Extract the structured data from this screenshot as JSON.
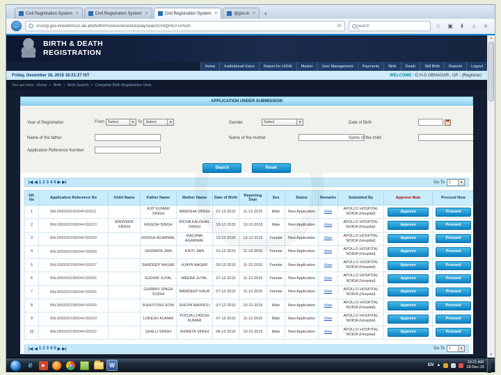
{
  "colors": {
    "navy": "#141d31",
    "menu_blue": "#1d3f68",
    "bar_blue": "#cfeaf8",
    "panel_title_blue": "#a5dff7",
    "button_blue": "#0b7fc0",
    "link_blue": "#2255bb",
    "alert_red": "#b00000"
  },
  "browser": {
    "tabs": [
      {
        "title": "Civil Registration System",
        "close": "×"
      },
      {
        "title": "Civil Registration System",
        "close": "×"
      },
      {
        "title": "Civil Registration System",
        "close": "×"
      },
      {
        "title": "@gov.in",
        "close": "×"
      }
    ],
    "new_tab": "+",
    "back_glyph": "←",
    "url": "crsorgi.gov.in/web/mccs.ab.arb/birth/Process/recordDisplaySearch/V9@HL0TA%20",
    "reload_glyph": "⟳",
    "search_placeholder": "Search",
    "toolbar_icons": {
      "star": "☆",
      "bookmarks": "▣",
      "download": "⬇",
      "home": "⌂",
      "menu": "≡"
    },
    "scrollbar": {
      "up": "▲",
      "down": "▼"
    }
  },
  "site": {
    "title_line1": "BIRTH & DEATH",
    "title_line2": "REGISTRATION",
    "nav": [
      "Home",
      "Institutional Users",
      "Report for UIDAI",
      "Master",
      "User Management",
      "Payments",
      "Birth",
      "Death",
      "Still Birth",
      "Reports",
      "Logout"
    ],
    "datetime": "Friday, December 18, 2015 18:21:27 IST",
    "welcome_label": "WELCOME :",
    "welcome_user": "D.H.O GBNAGAR , UP - (Registrar)",
    "breadcrumb_prefix": "You are here:",
    "breadcrumbs": [
      "Home",
      "Birth",
      "Birth Search",
      "Complete Birth Registration View"
    ]
  },
  "panel": {
    "title": "APPLICATION UNDER SUBMISSION",
    "form": {
      "year_label": "Year of Registration",
      "from_label": "From",
      "to_label": "To",
      "select_placeholder": "Select",
      "gender_label": "Gender",
      "dob_label": "Date of Birth",
      "father_label": "Name of the father",
      "mother_label": "Name of the mother",
      "child_label": "Name of the child",
      "appref_label": "Application Reference Number",
      "search_button": "Search",
      "reset_button": "Reset",
      "dropdown_arrow": "▾"
    },
    "pagination": {
      "first": "|◀",
      "prev": "◀",
      "next": "▶",
      "last": "▶|",
      "pages": [
        "1",
        "2",
        "3",
        "4",
        "5"
      ],
      "goto_label": "Go To",
      "goto_value": "1"
    },
    "table": {
      "headers": [
        "SR. No",
        "Application Reference No",
        "Child Name",
        "Father Name",
        "Mother Name",
        "Date of Birth",
        "Reporting Date",
        "Sex",
        "Status",
        "Remarks",
        "Submitted By",
        "Approve Now",
        "Proceed Now"
      ],
      "approve_button": "Approve",
      "proceed_button": "Proceed",
      "rows": [
        {
          "sr": "1",
          "ref": "BAL09900201950044-000211",
          "child": "",
          "father": "AJIT KUMAR SINGH",
          "mother": "MANISHA SINGH",
          "dob": "01-12-2015",
          "report": "11-12-2015",
          "sex": "Male",
          "status": "New Application",
          "remarks": "View",
          "submitted": "APOLLO HOSPITAL NOIDA (Hospital)"
        },
        {
          "sr": "2",
          "ref": "BAL09900201950044-000210",
          "child": "RANVEER SINGH",
          "father": "RAJESH SINGH",
          "mother": "RICHA KAUSHAL SINGH",
          "dob": "13-12-2015",
          "report": "13-12-2015",
          "sex": "Male",
          "status": "New Application",
          "remarks": "View",
          "submitted": "APOLLO HOSPITAL NOIDA (Hospital)"
        },
        {
          "sr": "3",
          "ref": "BAL09900201950044-000209",
          "child": "",
          "father": "ASHISH AGARWAL",
          "mother": "RACHNA AGARWAL",
          "dob": "13-12-2015",
          "report": "13-12-2015",
          "sex": "Female",
          "status": "New Application",
          "remarks": "View",
          "submitted": "APOLLO HOSPITAL NOIDA (Hospital)"
        },
        {
          "sr": "4",
          "ref": "BAL09900201950044-000208",
          "child": "",
          "father": "SASWATA JAIN",
          "mother": "KRITI JAIN",
          "dob": "01-12-2015",
          "report": "11-12-2015",
          "sex": "Female",
          "status": "New Application",
          "remarks": "View",
          "submitted": "APOLLO HOSPITAL NOIDA (Hospital)"
        },
        {
          "sr": "5",
          "ref": "BAL09900201950044-000207",
          "child": "",
          "father": "SANDEEP NAGAR",
          "mother": "AJAYA NAGAR",
          "dob": "09-12-2015",
          "report": "11-12-2015",
          "sex": "Female",
          "status": "New Application",
          "remarks": "View",
          "submitted": "APOLLO HOSPITAL NOIDA (Hospital)"
        },
        {
          "sr": "6",
          "ref": "BAL09900201950044-000206",
          "child": "",
          "father": "SUDHIR JUYAL",
          "mother": "MEENA JUYAL",
          "dob": "07-12-2015",
          "report": "11-12-2015",
          "sex": "Female",
          "status": "New Application",
          "remarks": "View",
          "submitted": "APOLLO HOSPITAL NOIDA (Hospital)"
        },
        {
          "sr": "7",
          "ref": "BAL09900201950044-000205",
          "child": "",
          "father": "GURBAX SINGH SODHI",
          "mother": "MANDEEP KAUR",
          "dob": "07-12-2015",
          "report": "11-12-2015",
          "sex": "Female",
          "status": "New Application",
          "remarks": "View",
          "submitted": "APOLLO HOSPITAL NOIDA (Hospital)"
        },
        {
          "sr": "8",
          "ref": "BAL09900201950044-000204",
          "child": "",
          "father": "ASHUTOSH SONI",
          "mother": "SHILPA NARNOLI",
          "dob": "07-12-2015",
          "report": "10-12-2015",
          "sex": "Male",
          "status": "New Application",
          "remarks": "View",
          "submitted": "APOLLO HOSPITAL NOIDA (Hospital)"
        },
        {
          "sr": "9",
          "ref": "BAL09900201950044-000203",
          "child": "",
          "father": "LOKESH KUMAR",
          "mother": "POOJA LOKESH KUMAR",
          "dob": "07-12-2015",
          "report": "11-12-2015",
          "sex": "Male",
          "status": "New Application",
          "remarks": "View",
          "submitted": "APOLLO HOSPITAL NOIDA (Hospital)"
        },
        {
          "sr": "10",
          "ref": "BAL09900201950044-000202",
          "child": "",
          "father": "SHALU SINGH",
          "mother": "SHWETA SINGH",
          "dob": "06-12-2015",
          "report": "10-12-2015",
          "sex": "Male",
          "status": "New Application",
          "remarks": "View",
          "submitted": "APOLLO HOSPITAL NOIDA (Hospital)"
        }
      ]
    }
  },
  "taskbar": {
    "icons": [
      "internet-explorer",
      "media-player",
      "firefox",
      "chrome",
      "sticky-notes",
      "file-explorer",
      "word"
    ],
    "ie_glyph": "e",
    "media_glyph": "▶",
    "word_glyph": "W",
    "tray": {
      "up": "▲",
      "lang": "EN",
      "time": "10:21 AM",
      "date": "18-Dec-15"
    }
  }
}
